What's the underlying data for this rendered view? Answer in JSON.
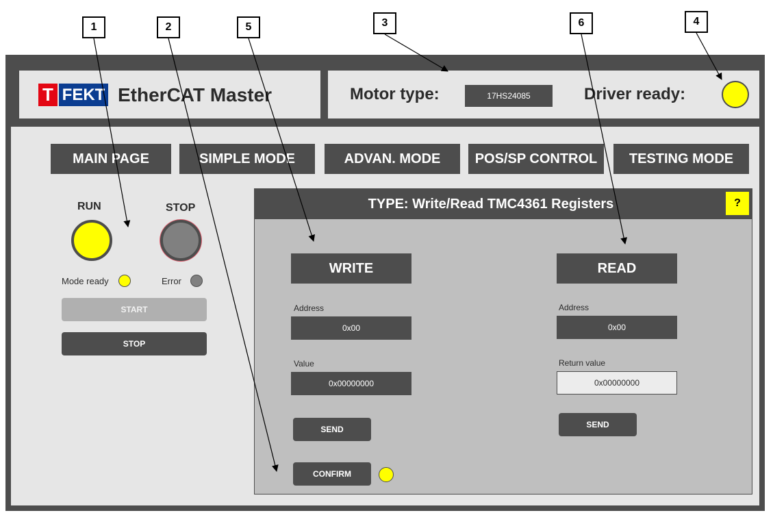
{
  "callouts": [
    "1",
    "2",
    "5",
    "3",
    "6",
    "4"
  ],
  "header": {
    "logo_t": "T",
    "logo_fekt": "FEKT",
    "app_title": "EtherCAT Master",
    "motor_type_label": "Motor type:",
    "motor_type_value": "17HS24085",
    "driver_ready_label": "Driver ready:"
  },
  "nav": {
    "tabs": [
      "MAIN PAGE",
      "SIMPLE MODE",
      "ADVAN. MODE",
      "POS/SP CONTROL",
      "TESTING MODE"
    ]
  },
  "left_panel": {
    "run_label": "RUN",
    "stop_label": "STOP",
    "mode_ready_label": "Mode ready",
    "error_label": "Error",
    "start_button": "START",
    "stop_button": "STOP"
  },
  "register_panel": {
    "title": "TYPE: Write/Read TMC4361 Registers",
    "help": "?",
    "write": {
      "heading": "WRITE",
      "address_label": "Address",
      "address_value": "0x00",
      "value_label": "Value",
      "value_value": "0x00000000",
      "send_button": "SEND",
      "confirm_button": "CONFIRM"
    },
    "read": {
      "heading": "READ",
      "address_label": "Address",
      "address_value": "0x00",
      "return_label": "Return value",
      "return_value": "0x00000000",
      "send_button": "SEND"
    }
  },
  "colors": {
    "frame": "#4d4d4d",
    "panel": "#e6e6e6",
    "register_bg": "#bfbfbf",
    "led_on": "#ffff00",
    "led_off": "#808080",
    "logo_red": "#e30613",
    "logo_blue": "#0b3d91"
  }
}
